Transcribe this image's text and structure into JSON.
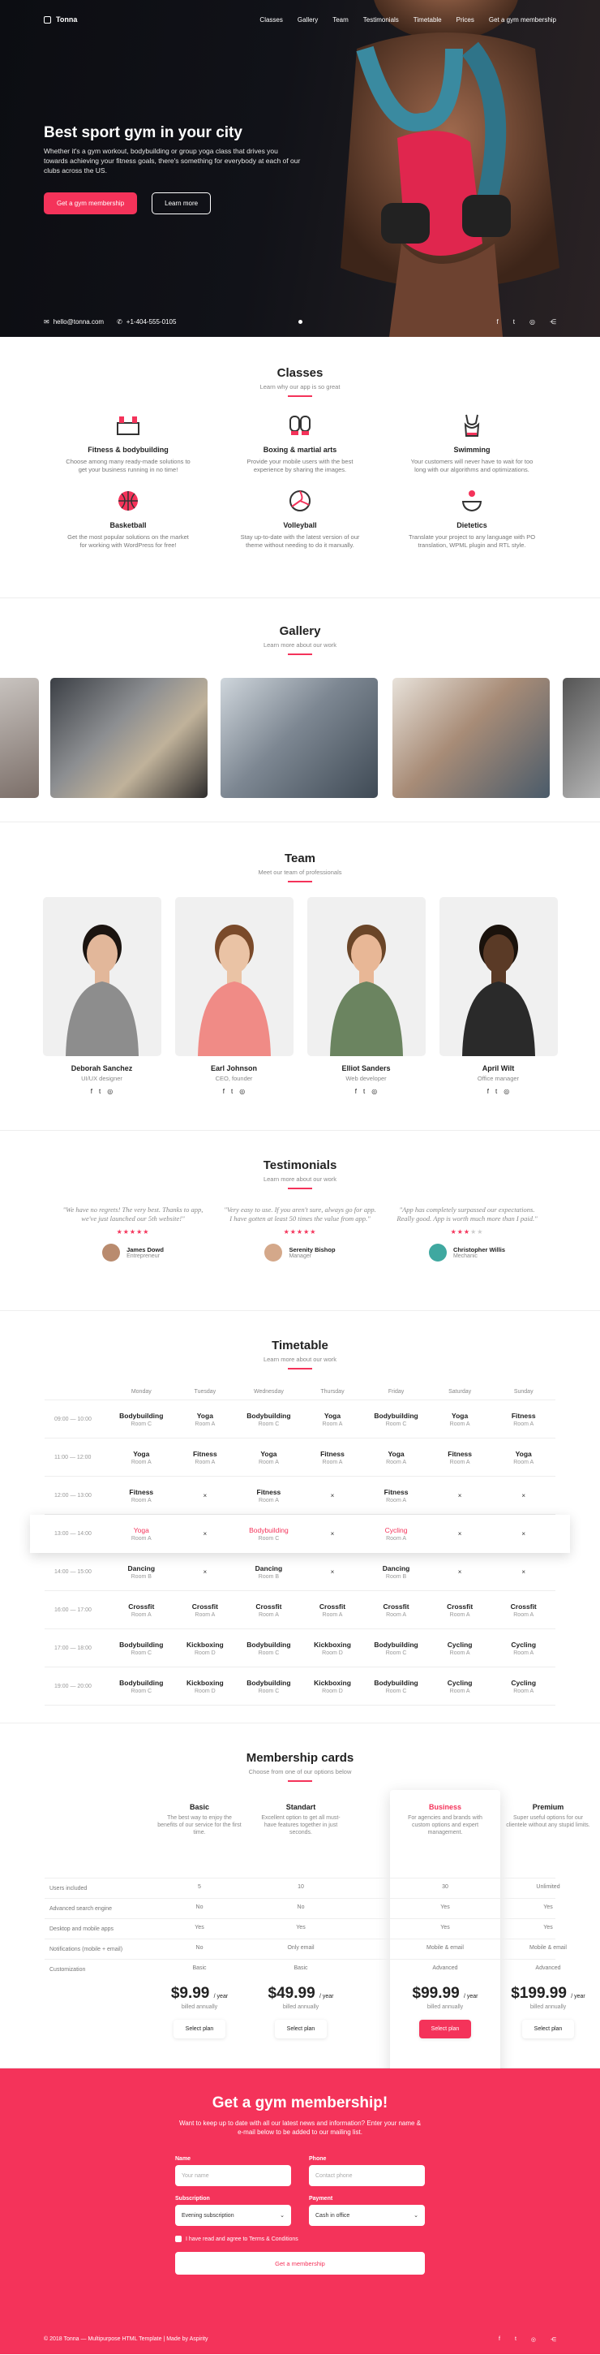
{
  "nav": {
    "brand": "Tonna",
    "items": [
      "Classes",
      "Gallery",
      "Team",
      "Testimonials",
      "Timetable",
      "Prices",
      "Get a gym membership"
    ]
  },
  "hero": {
    "title": "Best sport gym in your city",
    "lead": "Whether it's a gym workout, bodybuilding or group yoga class that drives you towards achieving your fitness goals, there's something for everybody at each of our clubs across the US.",
    "cta_primary": "Get a gym membership",
    "cta_secondary": "Learn more",
    "email": "hello@tonna.com",
    "phone": "+1-404-555-0105",
    "social_icons": [
      "facebook-icon",
      "twitter-icon",
      "instagram-icon",
      "share-icon"
    ]
  },
  "classes": {
    "title": "Classes",
    "subtitle": "Learn why our app is so great",
    "items": [
      {
        "title": "Fitness & bodybuilding",
        "desc": "Choose among many ready-made solutions to get your business running in no time!",
        "icon": "gym-icon"
      },
      {
        "title": "Boxing & martial arts",
        "desc": "Provide your mobile users with the best experience by sharing the images.",
        "icon": "boxing-gloves-icon"
      },
      {
        "title": "Swimming",
        "desc": "Your customers will never have to wait for too long with our algorithms and optimizations.",
        "icon": "swimsuit-icon"
      },
      {
        "title": "Basketball",
        "desc": "Get the most popular solutions on the market for working with WordPress for free!",
        "icon": "basketball-icon"
      },
      {
        "title": "Volleyball",
        "desc": "Stay up-to-date with the latest version of our theme without needing to do it manually.",
        "icon": "volleyball-icon"
      },
      {
        "title": "Dietetics",
        "desc": "Translate your project to any language with PO translation, WPML plugin and RTL style.",
        "icon": "diet-icon"
      }
    ]
  },
  "gallery": {
    "title": "Gallery",
    "subtitle": "Learn more about our work"
  },
  "team": {
    "title": "Team",
    "subtitle": "Meet our team of professionals",
    "members": [
      {
        "name": "Deborah Sanchez",
        "role": "UI/UX designer",
        "shirt": "#8d8d8d",
        "skin": "#e2b79a",
        "hair": "#1b1410"
      },
      {
        "name": "Earl Johnson",
        "role": "CEO, founder",
        "shirt": "#f08b86",
        "skin": "#eac3a5",
        "hair": "#7a4a2a"
      },
      {
        "name": "Elliot Sanders",
        "role": "Web developer",
        "shirt": "#6b8460",
        "skin": "#e8b796",
        "hair": "#6a4528"
      },
      {
        "name": "April Wilt",
        "role": "Office manager",
        "shirt": "#2a2a2a",
        "skin": "#5a3a26",
        "hair": "#1a120c"
      }
    ]
  },
  "testimonials": {
    "title": "Testimonials",
    "subtitle": "Learn more about our work",
    "items": [
      {
        "quote": "\"We have no regrets! The very best. Thanks to app, we've just launched our 5th website!\"",
        "name": "James Dowd",
        "role": "Entrepreneur",
        "rating": 5
      },
      {
        "quote": "\"Very easy to use. If you aren't sure, always go for app. I have gotten at least 50 times the value from app.\"",
        "name": "Serenity Bishop",
        "role": "Manager",
        "rating": 5
      },
      {
        "quote": "\"App has completely surpassed our expectations. Really good. App is worth much more than I paid.\"",
        "name": "Christopher Willis",
        "role": "Mechanic",
        "rating": 3
      }
    ]
  },
  "timetable": {
    "title": "Timetable",
    "subtitle": "Learn more about our work",
    "days": [
      "Monday",
      "Tuesday",
      "Wednesday",
      "Thursday",
      "Friday",
      "Saturday",
      "Sunday"
    ],
    "rows": [
      {
        "time": "09:00 — 10:00",
        "cells": [
          [
            "Bodybuilding",
            "Room C"
          ],
          [
            "Yoga",
            "Room A"
          ],
          [
            "Bodybuilding",
            "Room C"
          ],
          [
            "Yoga",
            "Room A"
          ],
          [
            "Bodybuilding",
            "Room C"
          ],
          [
            "Yoga",
            "Room A"
          ],
          [
            "Fitness",
            "Room A"
          ]
        ]
      },
      {
        "time": "11:00 — 12:00",
        "cells": [
          [
            "Yoga",
            "Room A"
          ],
          [
            "Fitness",
            "Room A"
          ],
          [
            "Yoga",
            "Room A"
          ],
          [
            "Fitness",
            "Room A"
          ],
          [
            "Yoga",
            "Room A"
          ],
          [
            "Fitness",
            "Room A"
          ],
          [
            "Yoga",
            "Room A"
          ]
        ]
      },
      {
        "time": "12:00 — 13:00",
        "cells": [
          [
            "Fitness",
            "Room A"
          ],
          [
            "×",
            ""
          ],
          [
            "Fitness",
            "Room A"
          ],
          [
            "×",
            ""
          ],
          [
            "Fitness",
            "Room A"
          ],
          [
            "×",
            ""
          ],
          [
            "×",
            ""
          ]
        ]
      },
      {
        "time": "13:00 — 14:00",
        "cells": [
          [
            "Yoga",
            "Room A"
          ],
          [
            "×",
            ""
          ],
          [
            "Bodybuilding",
            "Room C"
          ],
          [
            "×",
            ""
          ],
          [
            "Cycling",
            "Room A"
          ],
          [
            "×",
            ""
          ],
          [
            "×",
            ""
          ]
        ]
      },
      {
        "time": "14:00 — 15:00",
        "cells": [
          [
            "Dancing",
            "Room B"
          ],
          [
            "×",
            ""
          ],
          [
            "Dancing",
            "Room B"
          ],
          [
            "×",
            ""
          ],
          [
            "Dancing",
            "Room B"
          ],
          [
            "×",
            ""
          ],
          [
            "×",
            ""
          ]
        ]
      },
      {
        "time": "16:00 — 17:00",
        "cells": [
          [
            "Crossfit",
            "Room A"
          ],
          [
            "Crossfit",
            "Room A"
          ],
          [
            "Crossfit",
            "Room A"
          ],
          [
            "Crossfit",
            "Room A"
          ],
          [
            "Crossfit",
            "Room A"
          ],
          [
            "Crossfit",
            "Room A"
          ],
          [
            "Crossfit",
            "Room A"
          ]
        ]
      },
      {
        "time": "17:00 — 18:00",
        "cells": [
          [
            "Bodybuilding",
            "Room C"
          ],
          [
            "Kickboxing",
            "Room D"
          ],
          [
            "Bodybuilding",
            "Room C"
          ],
          [
            "Kickboxing",
            "Room D"
          ],
          [
            "Bodybuilding",
            "Room C"
          ],
          [
            "Cycling",
            "Room A"
          ],
          [
            "Cycling",
            "Room A"
          ]
        ]
      },
      {
        "time": "19:00 — 20:00",
        "cells": [
          [
            "Bodybuilding",
            "Room C"
          ],
          [
            "Kickboxing",
            "Room D"
          ],
          [
            "Bodybuilding",
            "Room C"
          ],
          [
            "Kickboxing",
            "Room D"
          ],
          [
            "Bodybuilding",
            "Room C"
          ],
          [
            "Cycling",
            "Room A"
          ],
          [
            "Cycling",
            "Room A"
          ]
        ]
      }
    ]
  },
  "membership": {
    "title": "Membership cards",
    "subtitle": "Choose from one of our options below",
    "row_labels": [
      "Users included",
      "Advanced search engine",
      "Desktop and mobile apps",
      "Notifications (mobile + email)",
      "Customization"
    ],
    "plans": [
      {
        "name": "Basic",
        "desc": "The best way to enjoy the benefits of our service for the first time.",
        "values": [
          "5",
          "No",
          "Yes",
          "No",
          "Basic"
        ],
        "price": "$9.99",
        "period": "/ year",
        "billed": "billed annually",
        "button": "Select plan"
      },
      {
        "name": "Standart",
        "desc": "Excellent option to get all must-have features together in just seconds.",
        "values": [
          "10",
          "No",
          "Yes",
          "Only email",
          "Basic"
        ],
        "price": "$49.99",
        "period": "/ year",
        "billed": "billed annually",
        "button": "Select plan"
      },
      {
        "name": "Business",
        "desc": "For agencies and brands with custom options and expert management.",
        "values": [
          "30",
          "Yes",
          "Yes",
          "Mobile & email",
          "Advanced"
        ],
        "price": "$99.99",
        "period": "/ year",
        "billed": "billed annually",
        "button": "Select plan"
      },
      {
        "name": "Premium",
        "desc": "Super useful options for our clientele without any stupid limits.",
        "values": [
          "Unlimited",
          "Yes",
          "Yes",
          "Mobile & email",
          "Advanced"
        ],
        "price": "$199.99",
        "period": "/ year",
        "billed": "billed annually",
        "button": "Select plan"
      }
    ]
  },
  "cta": {
    "title": "Get a gym membership!",
    "text": "Want to keep up to date with all our latest news and information? Enter your name & e-mail below to be added to our mailing list.",
    "name_label": "Name",
    "name_placeholder": "Your name",
    "phone_label": "Phone",
    "phone_placeholder": "Contact phone",
    "subscription_label": "Subscription",
    "subscription_value": "Evening subscription",
    "payment_label": "Payment",
    "payment_value": "Cash in office",
    "agree": "I have read and agree to Terms & Conditions",
    "submit": "Get a membership"
  },
  "footer": {
    "copy": "© 2018 Tonna — Multipurpose HTML Template | Made by Aspirity"
  },
  "colors": {
    "accent": "#f4335a",
    "hero_bg": "#111218"
  }
}
